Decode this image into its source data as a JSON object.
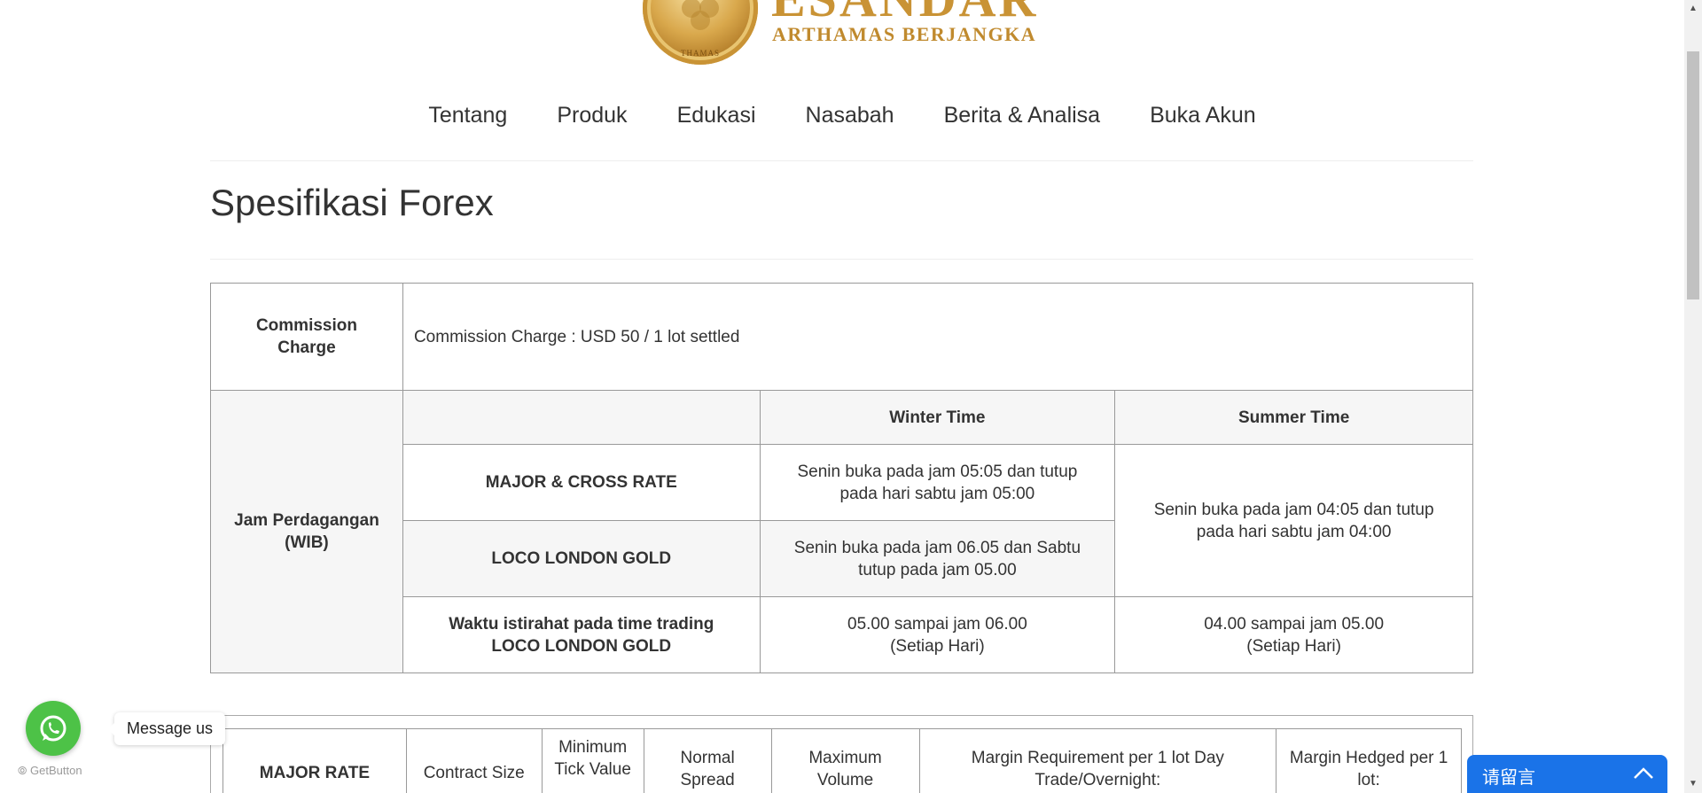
{
  "logo": {
    "wordmark": "ESANDAR",
    "subtitle": "ARTHAMAS BERJANGKA",
    "seal_text": "THAMAS"
  },
  "nav": {
    "items": [
      {
        "label": "Tentang"
      },
      {
        "label": "Produk"
      },
      {
        "label": "Edukasi"
      },
      {
        "label": "Nasabah"
      },
      {
        "label": "Berita & Analisa"
      },
      {
        "label": "Buka Akun"
      }
    ]
  },
  "page": {
    "title": "Spesifikasi Forex"
  },
  "spec_table": {
    "commission_label": "Commission Charge",
    "commission_value": "Commission Charge : USD 50 / 1 lot settled",
    "trading_hours_label": "Jam Perdagangan (WIB)",
    "col_winter": "Winter Time",
    "col_summer": "Summer Time",
    "rows": [
      {
        "label": "MAJOR & CROSS RATE",
        "winter": "Senin buka pada jam 05:05 dan tutup pada hari sabtu jam 05:00"
      },
      {
        "label": "LOCO LONDON GOLD",
        "winter": "Senin buka pada jam 06.05 dan Sabtu tutup pada jam 05.00"
      },
      {
        "label": "Waktu istirahat pada time trading LOCO LONDON GOLD",
        "winter": "05.00 sampai jam 06.00 (Setiap Hari)",
        "summer": "04.00 sampai jam 05.00 (Setiap Hari)"
      }
    ],
    "summer_shared": "Senin buka pada jam 04:05 dan tutup pada hari sabtu jam 04:00"
  },
  "rates_table": {
    "headers": [
      "MAJOR RATE",
      "Contract Size",
      "Minimum Tick Value",
      "Normal Spread",
      "Maximum Volume",
      "Margin Requirement per 1 lot Day Trade/Overnight:",
      "Margin Hedged per 1 lot:"
    ]
  },
  "widgets": {
    "whatsapp_tooltip": "Message us",
    "getbutton_credit": "GetButton",
    "chat_title": "请留言"
  },
  "colors": {
    "gold": "#c99335",
    "whatsapp_green": "#4dc247",
    "chat_blue": "#1a73e8",
    "table_border": "#999999",
    "table_shade": "#f6f6f6"
  }
}
